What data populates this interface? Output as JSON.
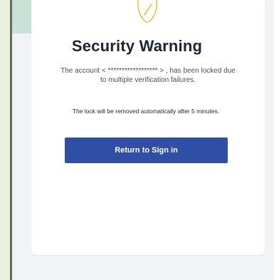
{
  "dialog": {
    "title": "Security Warning",
    "description_line1": "The account < ****************** > , has been locked due",
    "description_line2": "to multiple verification failures.",
    "info": "The lock will be removed automatically after 5 minutes.",
    "button_label": "Return to Sign in"
  },
  "colors": {
    "accent": "#2f4fa7",
    "warning_icon": "#f0c13d",
    "card": "#ffffff",
    "background": "#f2f3f5"
  },
  "icons": {
    "warning": "warning-icon"
  }
}
